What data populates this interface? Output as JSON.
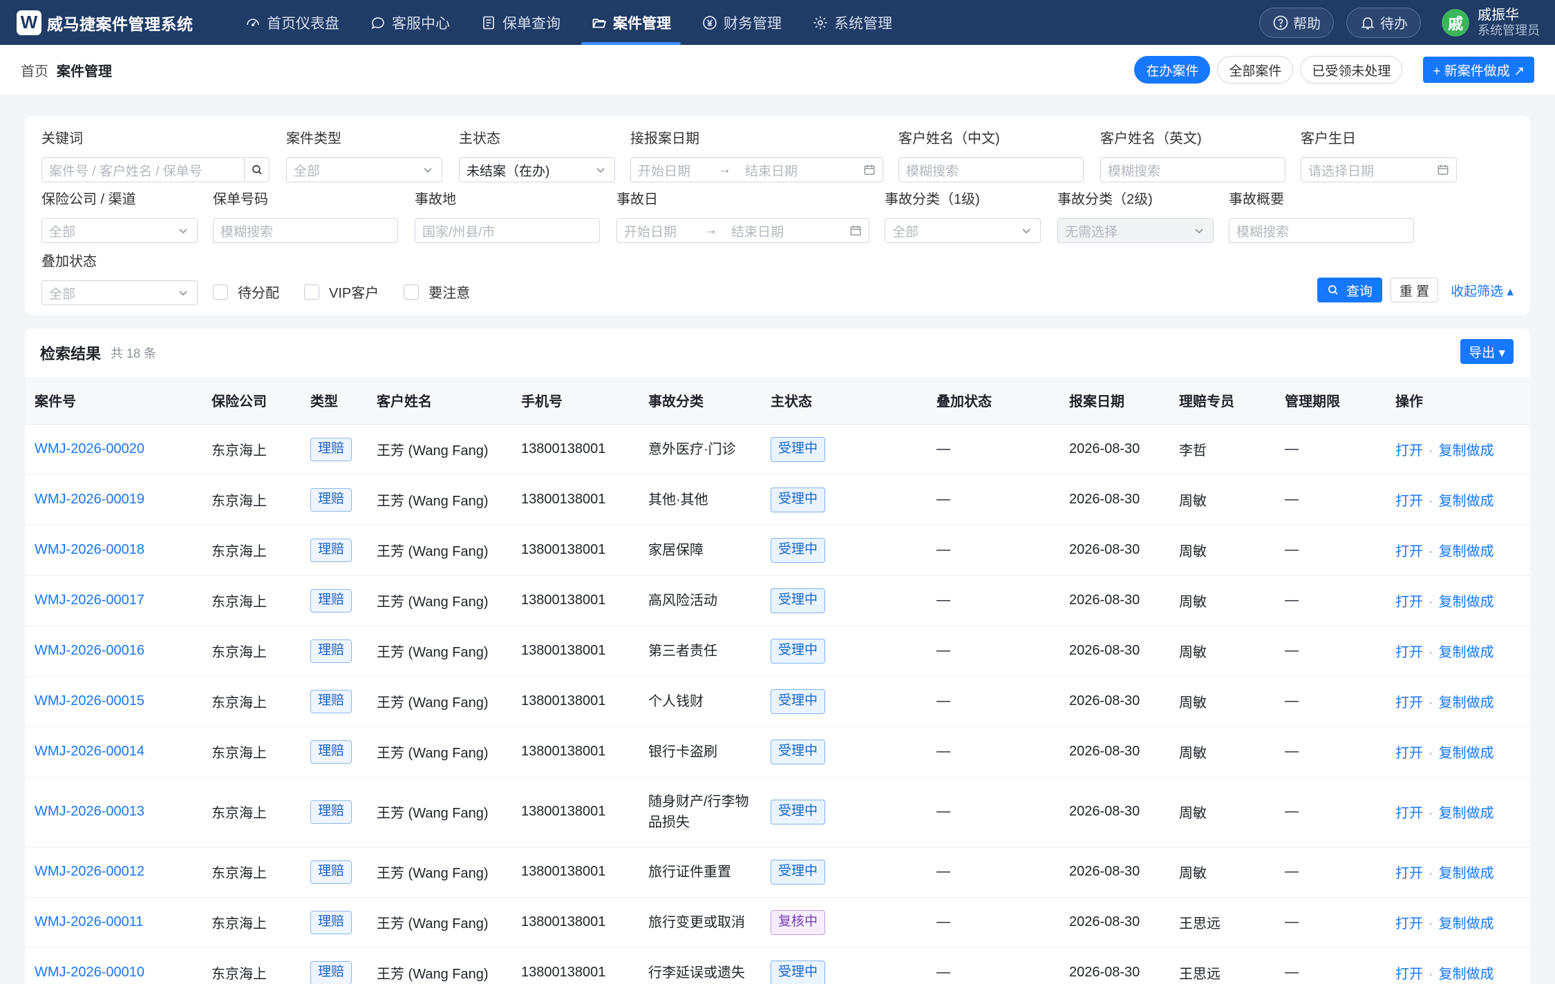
{
  "app": {
    "logo_letter": "W",
    "title": "威马捷案件管理系统"
  },
  "nav": [
    {
      "label": "首页仪表盘",
      "icon": "dashboard-icon",
      "active": false
    },
    {
      "label": "客服中心",
      "icon": "chat-icon",
      "active": false
    },
    {
      "label": "保单查询",
      "icon": "document-icon",
      "active": false
    },
    {
      "label": "案件管理",
      "icon": "folder-icon",
      "active": true
    },
    {
      "label": "财务管理",
      "icon": "yen-icon",
      "active": false
    },
    {
      "label": "系统管理",
      "icon": "gear-icon",
      "active": false
    }
  ],
  "topright": {
    "help": "帮助",
    "todo": "待办",
    "user_initial": "戚",
    "user_name": "戚振华",
    "user_role": "系统管理员"
  },
  "breadcrumb": {
    "home": "首页",
    "current": "案件管理"
  },
  "view_tabs": [
    {
      "label": "在办案件",
      "active": true
    },
    {
      "label": "全部案件",
      "active": false
    },
    {
      "label": "已受领未处理",
      "active": false
    }
  ],
  "new_case_label": "+ 新案件做成 ↗",
  "filters": {
    "keyword": {
      "label": "关键词",
      "placeholder": "案件号 / 客户姓名 / 保单号"
    },
    "case_type": {
      "label": "案件类型",
      "placeholder": "全部"
    },
    "main_status": {
      "label": "主状态",
      "value": "未结案（在办)"
    },
    "report_date": {
      "label": "接报案日期",
      "start": "开始日期",
      "arrow": "→",
      "end": "结束日期"
    },
    "name_cn": {
      "label": "客户姓名（中文)",
      "placeholder": "模糊搜索"
    },
    "name_en": {
      "label": "客户姓名（英文)",
      "placeholder": "模糊搜索"
    },
    "birthday": {
      "label": "客户生日",
      "placeholder": "请选择日期"
    },
    "insurer": {
      "label": "保险公司 / 渠道",
      "placeholder": "全部"
    },
    "policy_no": {
      "label": "保单号码",
      "placeholder": "模糊搜索"
    },
    "accident_place": {
      "label": "事故地",
      "placeholder": "国家/州县/市"
    },
    "accident_date": {
      "label": "事故日",
      "start": "开始日期",
      "arrow": "→",
      "end": "结束日期"
    },
    "cat1": {
      "label": "事故分类（1级)",
      "placeholder": "全部"
    },
    "cat2": {
      "label": "事故分类（2级)",
      "placeholder": "无需选择"
    },
    "summary": {
      "label": "事故概要",
      "placeholder": "模糊搜索"
    },
    "overlay": {
      "label": "叠加状态",
      "placeholder": "全部"
    },
    "checkboxes": [
      "待分配",
      "VIP客户",
      "要注意"
    ],
    "query_label": "查询",
    "reset_label": "重 置",
    "collapse_label": "收起筛选 ▴"
  },
  "results": {
    "title": "检索结果",
    "count": "共 18 条",
    "export_label": "导出 ▾",
    "columns": [
      "案件号",
      "保险公司",
      "类型",
      "客户姓名",
      "手机号",
      "事故分类",
      "主状态",
      "叠加状态",
      "报案日期",
      "理赔专员",
      "管理期限",
      "操作"
    ],
    "rows": [
      {
        "case_no": "WMJ-2026-00020",
        "insurer": "东京海上",
        "type": "理赔",
        "name": "王芳 (Wang Fang)",
        "phone": "13800138001",
        "category": "意外医疗·门诊",
        "status": "受理中",
        "status_kind": "active",
        "overlay": "—",
        "report_date": "2026-08-30",
        "agent": "李哲",
        "deadline": "—",
        "op_open": "打开",
        "op_sep": "·",
        "op_copy": "复制做成"
      },
      {
        "case_no": "WMJ-2026-00019",
        "insurer": "东京海上",
        "type": "理赔",
        "name": "王芳 (Wang Fang)",
        "phone": "13800138001",
        "category": "其他·其他",
        "status": "受理中",
        "status_kind": "active",
        "overlay": "—",
        "report_date": "2026-08-30",
        "agent": "周敏",
        "deadline": "—",
        "op_open": "打开",
        "op_sep": "·",
        "op_copy": "复制做成"
      },
      {
        "case_no": "WMJ-2026-00018",
        "insurer": "东京海上",
        "type": "理赔",
        "name": "王芳 (Wang Fang)",
        "phone": "13800138001",
        "category": "家居保障",
        "status": "受理中",
        "status_kind": "active",
        "overlay": "—",
        "report_date": "2026-08-30",
        "agent": "周敏",
        "deadline": "—",
        "op_open": "打开",
        "op_sep": "·",
        "op_copy": "复制做成"
      },
      {
        "case_no": "WMJ-2026-00017",
        "insurer": "东京海上",
        "type": "理赔",
        "name": "王芳 (Wang Fang)",
        "phone": "13800138001",
        "category": "高风险活动",
        "status": "受理中",
        "status_kind": "active",
        "overlay": "—",
        "report_date": "2026-08-30",
        "agent": "周敏",
        "deadline": "—",
        "op_open": "打开",
        "op_sep": "·",
        "op_copy": "复制做成"
      },
      {
        "case_no": "WMJ-2026-00016",
        "insurer": "东京海上",
        "type": "理赔",
        "name": "王芳 (Wang Fang)",
        "phone": "13800138001",
        "category": "第三者责任",
        "status": "受理中",
        "status_kind": "active",
        "overlay": "—",
        "report_date": "2026-08-30",
        "agent": "周敏",
        "deadline": "—",
        "op_open": "打开",
        "op_sep": "·",
        "op_copy": "复制做成"
      },
      {
        "case_no": "WMJ-2026-00015",
        "insurer": "东京海上",
        "type": "理赔",
        "name": "王芳 (Wang Fang)",
        "phone": "13800138001",
        "category": "个人钱财",
        "status": "受理中",
        "status_kind": "active",
        "overlay": "—",
        "report_date": "2026-08-30",
        "agent": "周敏",
        "deadline": "—",
        "op_open": "打开",
        "op_sep": "·",
        "op_copy": "复制做成"
      },
      {
        "case_no": "WMJ-2026-00014",
        "insurer": "东京海上",
        "type": "理赔",
        "name": "王芳 (Wang Fang)",
        "phone": "13800138001",
        "category": "银行卡盗刷",
        "status": "受理中",
        "status_kind": "active",
        "overlay": "—",
        "report_date": "2026-08-30",
        "agent": "周敏",
        "deadline": "—",
        "op_open": "打开",
        "op_sep": "·",
        "op_copy": "复制做成"
      },
      {
        "case_no": "WMJ-2026-00013",
        "insurer": "东京海上",
        "type": "理赔",
        "name": "王芳 (Wang Fang)",
        "phone": "13800138001",
        "category": "随身财产/行李物品损失",
        "status": "受理中",
        "status_kind": "active",
        "overlay": "—",
        "report_date": "2026-08-30",
        "agent": "周敏",
        "deadline": "—",
        "op_open": "打开",
        "op_sep": "·",
        "op_copy": "复制做成"
      },
      {
        "case_no": "WMJ-2026-00012",
        "insurer": "东京海上",
        "type": "理赔",
        "name": "王芳 (Wang Fang)",
        "phone": "13800138001",
        "category": "旅行证件重置",
        "status": "受理中",
        "status_kind": "active",
        "overlay": "—",
        "report_date": "2026-08-30",
        "agent": "周敏",
        "deadline": "—",
        "op_open": "打开",
        "op_sep": "·",
        "op_copy": "复制做成"
      },
      {
        "case_no": "WMJ-2026-00011",
        "insurer": "东京海上",
        "type": "理赔",
        "name": "王芳 (Wang Fang)",
        "phone": "13800138001",
        "category": "旅行变更或取消",
        "status": "复核中",
        "status_kind": "review",
        "overlay": "—",
        "report_date": "2026-08-30",
        "agent": "王思远",
        "deadline": "—",
        "op_open": "打开",
        "op_sep": "·",
        "op_copy": "复制做成"
      },
      {
        "case_no": "WMJ-2026-00010",
        "insurer": "东京海上",
        "type": "理赔",
        "name": "王芳 (Wang Fang)",
        "phone": "13800138001",
        "category": "行李延误或遗失",
        "status": "受理中",
        "status_kind": "active",
        "overlay": "—",
        "report_date": "2026-08-30",
        "agent": "王思远",
        "deadline": "—",
        "op_open": "打开",
        "op_sep": "·",
        "op_copy": "复制做成"
      }
    ]
  },
  "colors": {
    "nav_bg": "#1f3b66",
    "accent": "#1677ff",
    "page_bg": "#f3f5f8",
    "user_avatar": "#3bb55a"
  }
}
